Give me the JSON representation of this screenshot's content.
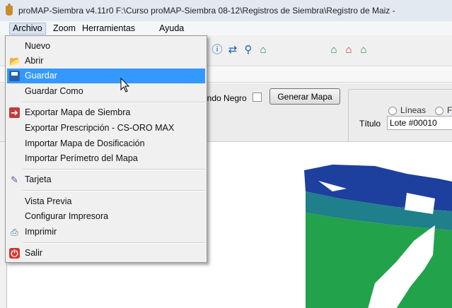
{
  "window": {
    "title": "proMAP-Siembra v4.11r0   F:\\Curso proMAP-Siembra 08-12\\Registros de Siembra\\Registro de Maiz -"
  },
  "menubar": [
    {
      "label": "Archivo"
    },
    {
      "label": "Zoom"
    },
    {
      "label": "Herramientas"
    },
    {
      "label": "Ayuda"
    }
  ],
  "file_menu": {
    "items": [
      {
        "label": "Nuevo",
        "icon": "none"
      },
      {
        "label": "Abrir",
        "icon": "folder-open-icon"
      },
      {
        "label": "Guardar",
        "icon": "floppy-disk-icon",
        "highlighted": true
      },
      {
        "label": "Guardar Como",
        "icon": "none"
      },
      {
        "label": "Exportar Mapa de Siembra",
        "icon": "export-icon"
      },
      {
        "label": "Exportar Prescripción - CS-ORO MAX",
        "icon": "none"
      },
      {
        "label": "Importar Mapa de Dosificación",
        "icon": "none"
      },
      {
        "label": "Importar Perímetro del Mapa",
        "icon": "none"
      },
      {
        "label": "Tarjeta",
        "icon": "card-icon"
      },
      {
        "label": "Vista Previa",
        "icon": "none"
      },
      {
        "label": "Configurar Impresora",
        "icon": "none"
      },
      {
        "label": "Imprimir",
        "icon": "printer-icon"
      },
      {
        "label": "Salir",
        "icon": "exit-icon"
      }
    ]
  },
  "options": {
    "fondo_negro_label": "ondo Negro",
    "fondo_negro_checked": false,
    "generate_button": "Generar Mapa",
    "radio_lineas": "Líneas",
    "radio_next": "F",
    "titulo_label": "Título",
    "titulo_value": "Lote #00010"
  },
  "colors": {
    "highlight": "#3399ff",
    "map_dark_blue": "#1d3f9e",
    "map_teal": "#1f7f8a",
    "map_green": "#22a24a"
  }
}
